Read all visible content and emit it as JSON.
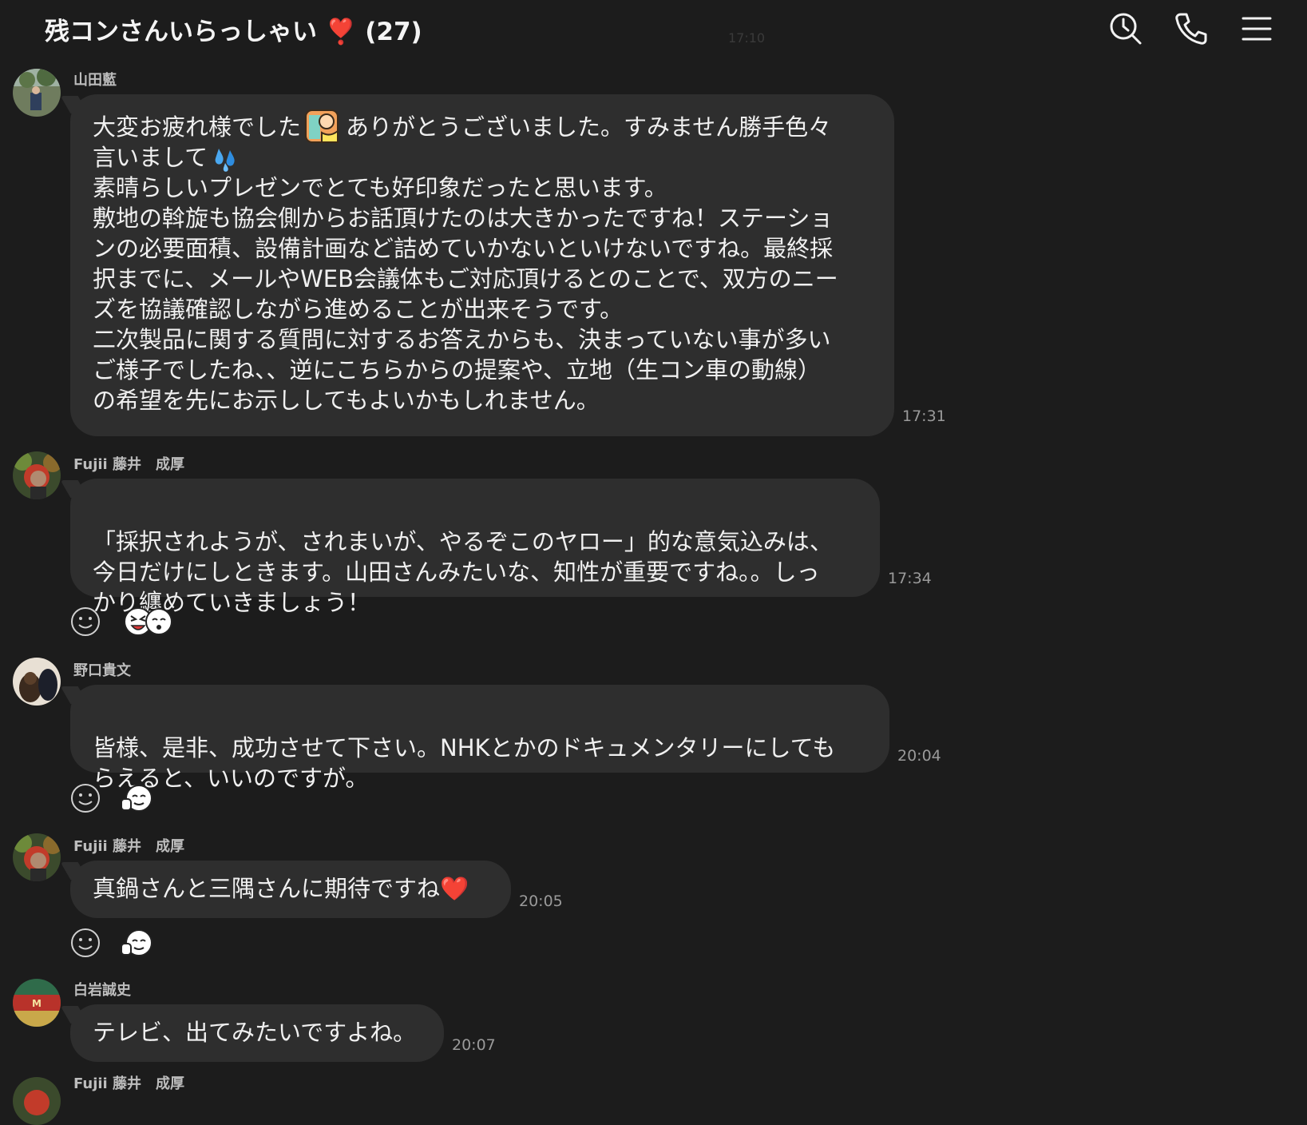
{
  "header": {
    "title": "残コンさんいらっしゃい",
    "heart": "❣️",
    "member_count": "(27)",
    "ghost_time": "17:10",
    "icons": [
      "clock-search-icon",
      "phone-icon",
      "menu-icon"
    ]
  },
  "messages": [
    {
      "sender": "山田藍",
      "text_line1a": "大変お疲れ様でした",
      "text_line1b": "ありがとうございました。すみません勝手色々",
      "text_line2": "言いまして",
      "text_rest": "素晴らしいプレゼンでとても好印象だったと思います。\n敷地の斡旋も協会側からお話頂けたのは大きかったですね！ステーショ\nンの必要面積、設備計画など詰めていかないといけないですね。最終採\n択までに、メールやWEB会議体もご対応頂けるとのことで、双方のニー\nズを協議確認しながら進めることが出来そうです。\n二次製品に関する質問に対するお答えからも、決まっていない事が多い\nご様子でしたね、、逆にこちらからの提案や、立地（生コン車の動線）\nの希望を先にお示ししてもよいかもしれません。",
      "time": "17:31"
    },
    {
      "sender": "Fujii 藤井　成厚",
      "text": "「採択されようが、されまいが、やるぞこのヤロー」的な意気込みは、\n今日だけにしときます。山田さんみたいな、知性が重要ですね。。しっ\nかり纏めていきましょう！",
      "time": "17:34"
    },
    {
      "sender": "野口貴文",
      "text": "皆様、是非、成功させて下さい。NHKとかのドキュメンタリーにしても\nらえると、いいのですが。",
      "time": "20:04"
    },
    {
      "sender": "Fujii 藤井　成厚",
      "text": "真鍋さんと三隅さんに期待ですね",
      "heart": "❤️",
      "time": "20:05"
    },
    {
      "sender": "白岩誠史",
      "text": "テレビ、出てみたいですよね。",
      "time": "20:07"
    },
    {
      "sender": "Fujii 藤井　成厚"
    }
  ],
  "colors": {
    "background": "#1c1c1c",
    "bubble": "#2e2e2e",
    "text": "#f0f0f0",
    "time": "#9a9a9a",
    "sender": "#bdbdbd"
  }
}
